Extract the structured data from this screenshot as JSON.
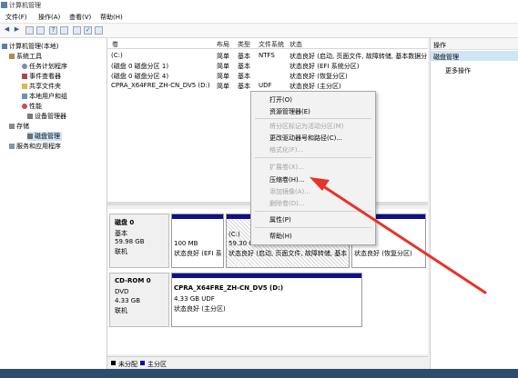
{
  "window": {
    "title": "计算机管理"
  },
  "menu": [
    {
      "label": "文件(F)"
    },
    {
      "label": "操作(A)"
    },
    {
      "label": "查看(V)"
    },
    {
      "label": "帮助(H)"
    }
  ],
  "tree": {
    "root": "计算机管理(本地)",
    "system_tools": "系统工具",
    "task_scheduler": "任务计划程序",
    "event_viewer": "事件查看器",
    "shared_folders": "共享文件夹",
    "local_users": "本地用户和组",
    "performance": "性能",
    "device_manager": "设备管理器",
    "storage": "存储",
    "disk_management": "磁盘管理",
    "services": "服务和应用程序"
  },
  "volume_table": {
    "columns": [
      "卷",
      "布局",
      "类型",
      "文件系统",
      "状态"
    ],
    "rows": [
      {
        "vol": "(C:)",
        "layout": "简单",
        "type": "基本",
        "fs": "NTFS",
        "status": "状态良好 (启动, 页面文件, 故障转储, 基本数据分"
      },
      {
        "vol": "(磁盘 0 磁盘分区 1)",
        "layout": "简单",
        "type": "基本",
        "fs": "",
        "status": "状态良好 (EFI 系统分区)"
      },
      {
        "vol": "(磁盘 0 磁盘分区 4)",
        "layout": "简单",
        "type": "基本",
        "fs": "",
        "status": "状态良好 (恢复分区)"
      },
      {
        "vol": "CPRA_X64FRE_ZH-CN_DV5 (D:)",
        "layout": "简单",
        "type": "基本",
        "fs": "UDF",
        "status": "状态良好 (主分区)"
      }
    ]
  },
  "disk0": {
    "name": "磁盘 0",
    "type": "基本",
    "size": "59.98 GB",
    "state": "联机",
    "partitions": [
      {
        "size": "100 MB",
        "status": "状态良好 (EFI 系"
      },
      {
        "name": "(C:)",
        "size": "59.30 G",
        "status": "状态良好 (启动, 页面文件, 故障转储, 基本"
      },
      {
        "status": "状态良好 (恢复分区)"
      }
    ]
  },
  "cdrom": {
    "name": "CD-ROM 0",
    "type": "DVD",
    "size": "4.33 GB",
    "state": "联机",
    "partition": {
      "name": "CPRA_X64FRE_ZH-CN_DV5  (D:)",
      "size": "4.33 GB UDF",
      "status": "状态良好 (主分区)"
    }
  },
  "legend": {
    "unallocated": "未分配",
    "primary": "主分区"
  },
  "actions": {
    "header": "操作",
    "selected": "磁盘管理",
    "more": "更多操作"
  },
  "context_menu": {
    "items": [
      {
        "label": "打开(O)",
        "enabled": true
      },
      {
        "label": "资源管理器(E)",
        "enabled": true
      },
      {
        "label": "将分区标记为活动分区(M)",
        "enabled": false
      },
      {
        "label": "更改驱动器号和路径(C)...",
        "enabled": true
      },
      {
        "label": "格式化(F)...",
        "enabled": false
      },
      {
        "label": "扩展卷(X)...",
        "enabled": false
      },
      {
        "label": "压缩卷(H)...",
        "enabled": true
      },
      {
        "label": "添加镜像(A)...",
        "enabled": false
      },
      {
        "label": "删除卷(D)...",
        "enabled": false
      },
      {
        "label": "属性(P)",
        "enabled": true
      },
      {
        "label": "帮助(H)",
        "enabled": true
      }
    ]
  },
  "colors": {
    "primary_partition": "#10108a",
    "unallocated": "#000000",
    "arrow": "#e8332a"
  }
}
